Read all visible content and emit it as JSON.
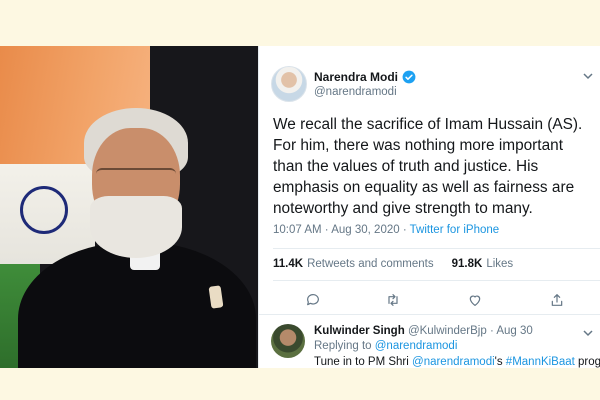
{
  "colors": {
    "accent": "#1b95e0",
    "page_bg": "#fdf8e2",
    "muted": "#657786"
  },
  "tweet": {
    "display_name": "Narendra Modi",
    "handle": "@narendramodi",
    "verified": true,
    "text": "We recall the sacrifice of Imam Hussain (AS). For him, there was nothing more important than the values of truth and justice. His emphasis on equality as well as fairness are noteworthy and give strength to many.",
    "time": "10:07 AM",
    "separator": "·",
    "date": "Aug 30, 2020",
    "app": "Twitter for iPhone",
    "retweets_count": "11.4K",
    "retweets_label": "Retweets and comments",
    "likes_count": "91.8K",
    "likes_label": "Likes",
    "icons": [
      "reply-icon",
      "retweet-icon",
      "like-icon",
      "share-icon",
      "verified-badge-icon",
      "chevron-down-icon"
    ]
  },
  "reply": {
    "display_name": "Kulwinder Singh",
    "handle": "@KulwinderBjp",
    "separator": "·",
    "date": "Aug 30",
    "replying_label": "Replying to",
    "replying_handle": "@narendramodi",
    "text_start": "Tune in to PM Shri ",
    "text_mention": "@narendramodi",
    "text_mid": "'s ",
    "text_hashtag": "#MannKiBaat",
    "text_end": " program"
  }
}
